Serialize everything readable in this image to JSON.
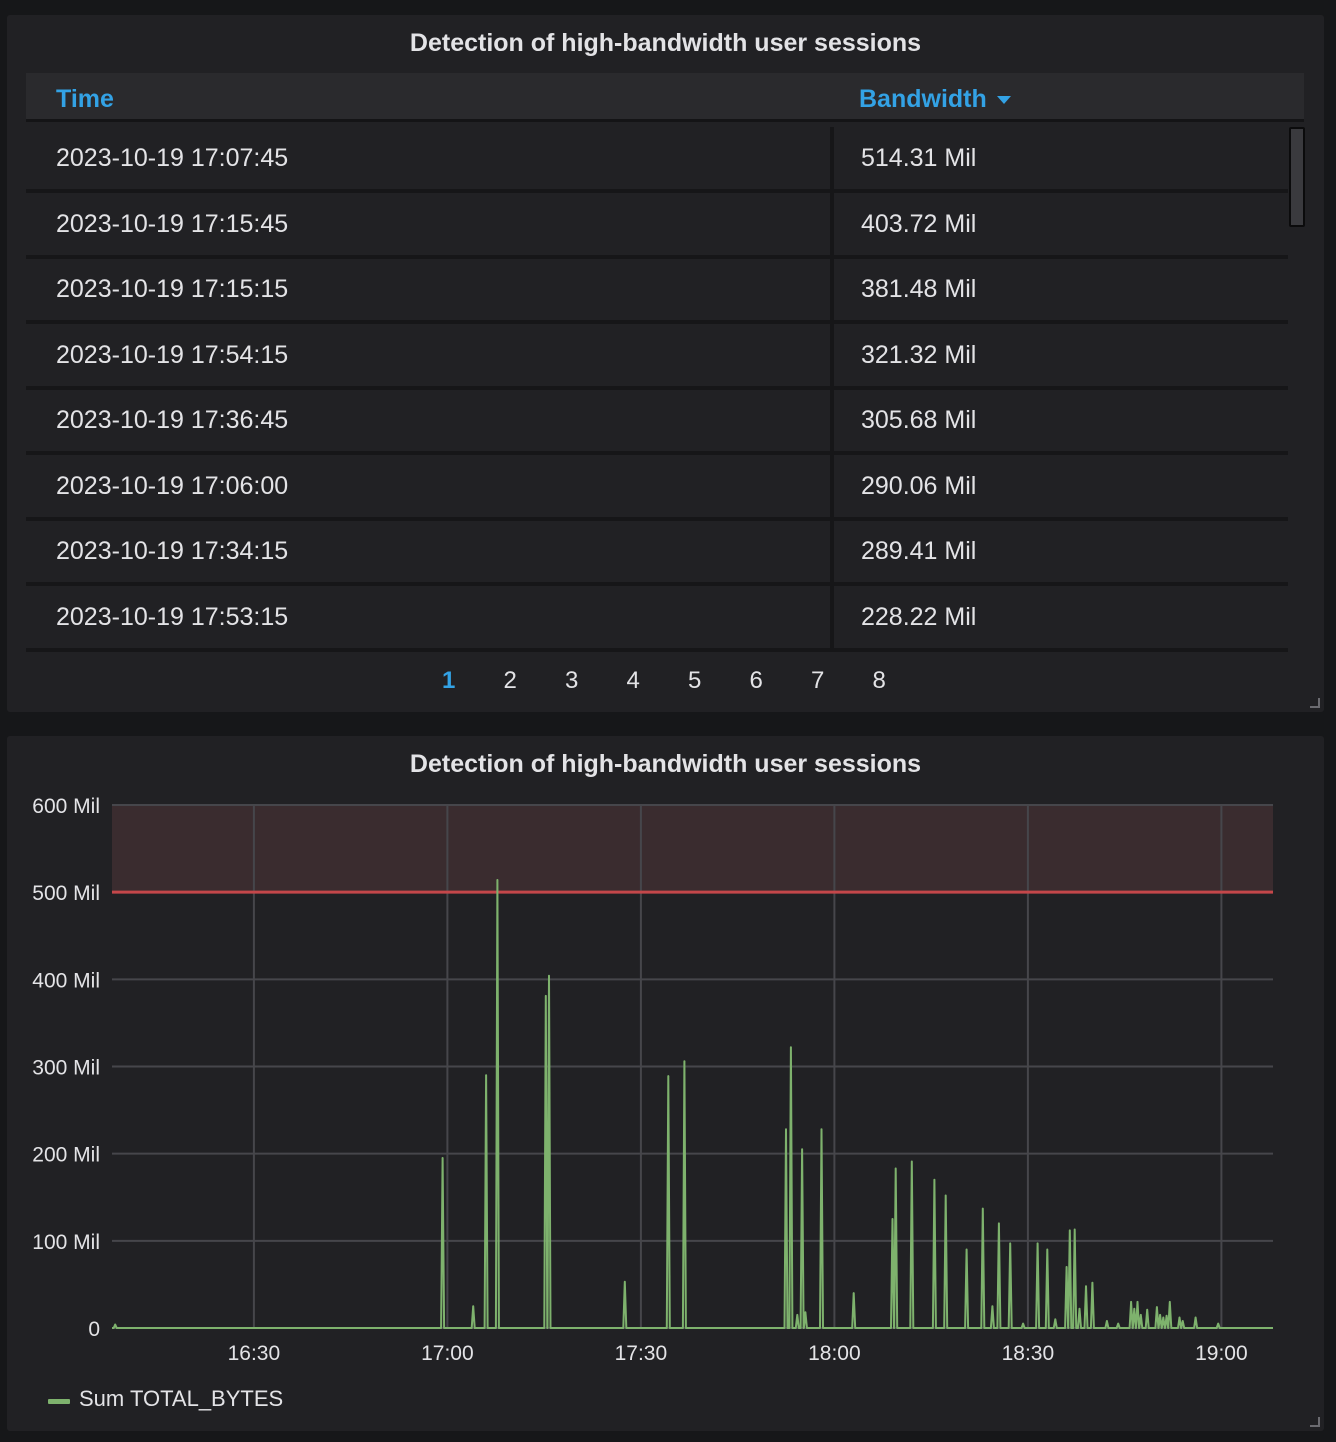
{
  "table_panel": {
    "title": "Detection of high-bandwidth user sessions",
    "columns": {
      "time": "Time",
      "bandwidth": "Bandwidth"
    },
    "rows": [
      {
        "time": "2023-10-19 17:07:45",
        "bandwidth": "514.31 Mil"
      },
      {
        "time": "2023-10-19 17:15:45",
        "bandwidth": "403.72 Mil"
      },
      {
        "time": "2023-10-19 17:15:15",
        "bandwidth": "381.48 Mil"
      },
      {
        "time": "2023-10-19 17:54:15",
        "bandwidth": "321.32 Mil"
      },
      {
        "time": "2023-10-19 17:36:45",
        "bandwidth": "305.68 Mil"
      },
      {
        "time": "2023-10-19 17:06:00",
        "bandwidth": "290.06 Mil"
      },
      {
        "time": "2023-10-19 17:34:15",
        "bandwidth": "289.41 Mil"
      },
      {
        "time": "2023-10-19 17:53:15",
        "bandwidth": "228.22 Mil"
      }
    ],
    "pages": [
      "1",
      "2",
      "3",
      "4",
      "5",
      "6",
      "7",
      "8"
    ],
    "active_page": "1",
    "accent_color": "#33a2e5"
  },
  "chart_panel": {
    "title": "Detection of high-bandwidth user sessions"
  },
  "chart_data": {
    "type": "line",
    "title": "Detection of high-bandwidth user sessions",
    "xlabel": "",
    "ylabel": "",
    "xlim": [
      "16:08",
      "19:08"
    ],
    "ylim": [
      0,
      600
    ],
    "x_tick_labels": [
      "16:30",
      "17:00",
      "17:30",
      "18:00",
      "18:30",
      "19:00"
    ],
    "y_tick_labels": [
      "0",
      "100 Mil",
      "200 Mil",
      "300 Mil",
      "400 Mil",
      "500 Mil",
      "600 Mil"
    ],
    "grid": true,
    "legend_placement": "bottom-left",
    "threshold": {
      "value": 500,
      "color": "#c4474a",
      "region_above": true
    },
    "series": [
      {
        "name": "Sum TOTAL_BYTES",
        "color": "#7eb26d",
        "x": [
          "16:08:30",
          "16:59:15",
          "17:04:00",
          "17:06:00",
          "17:07:45",
          "17:15:15",
          "17:15:45",
          "17:27:30",
          "17:34:15",
          "17:36:45",
          "17:52:30",
          "17:53:15",
          "17:54:15",
          "17:55:00",
          "17:55:30",
          "17:58:00",
          "18:03:00",
          "18:09:00",
          "18:09:30",
          "18:12:00",
          "18:15:30",
          "18:17:15",
          "18:20:30",
          "18:23:00",
          "18:24:30",
          "18:25:30",
          "18:27:15",
          "18:29:15",
          "18:31:30",
          "18:33:00",
          "18:34:15",
          "18:36:00",
          "18:36:30",
          "18:37:15",
          "18:38:00",
          "18:39:00",
          "18:40:00",
          "18:42:15",
          "18:44:00",
          "18:46:00",
          "18:46:30",
          "18:47:00",
          "18:47:30",
          "18:48:30",
          "18:50:00",
          "18:50:30",
          "18:51:00",
          "18:51:30",
          "18:52:00",
          "18:53:30",
          "18:54:00",
          "18:56:00",
          "18:59:30"
        ],
        "values": [
          4,
          195,
          25,
          290,
          514,
          381,
          404,
          53,
          289,
          306,
          228,
          322,
          15,
          205,
          18,
          228,
          40,
          125,
          183,
          191,
          170,
          152,
          90,
          137,
          25,
          120,
          97,
          5,
          97,
          90,
          10,
          70,
          112,
          113,
          22,
          48,
          52,
          8,
          5,
          30,
          22,
          30,
          15,
          21,
          24,
          15,
          12,
          14,
          30,
          12,
          8,
          12,
          5
        ]
      }
    ]
  }
}
